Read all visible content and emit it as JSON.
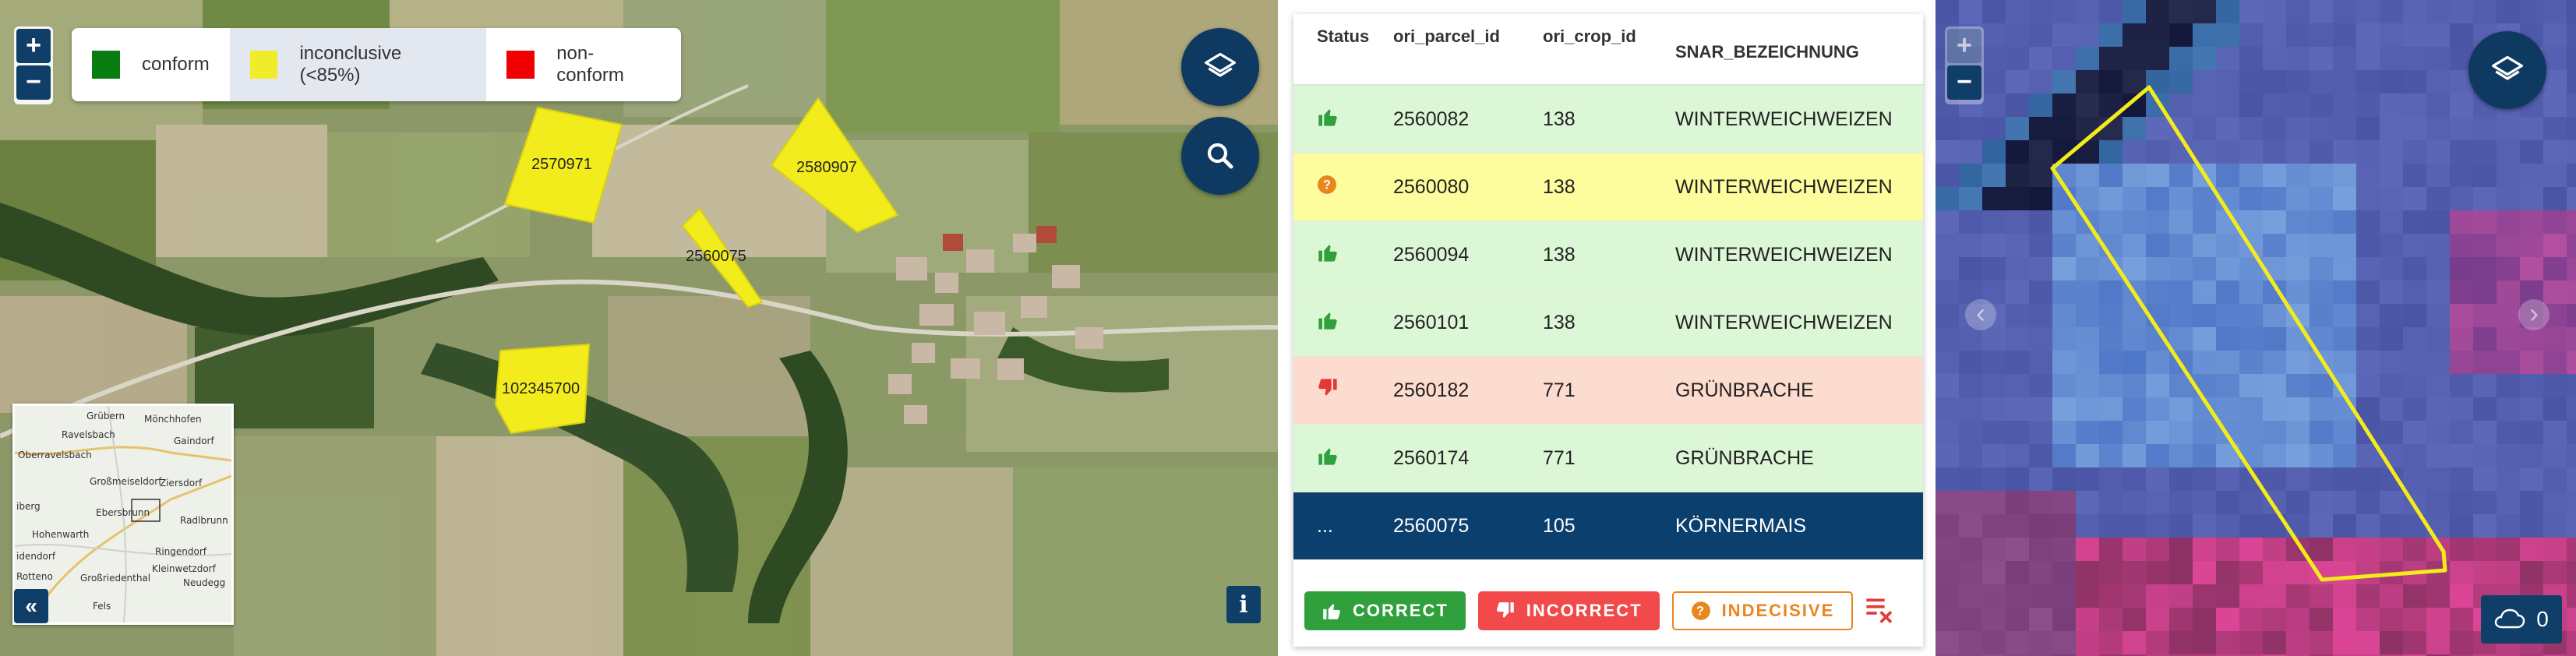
{
  "left_map": {
    "zoom_in": "+",
    "zoom_out": "−",
    "legend": [
      {
        "label": "conform",
        "color": "#0a7d12"
      },
      {
        "label": "inconclusive (<85%)",
        "color": "#f0ec2a",
        "active": true
      },
      {
        "label": "non-conform",
        "color": "#f00000"
      }
    ],
    "parcels": [
      "2570971",
      "2580907",
      "2560075",
      "102345700"
    ],
    "layers_icon": "layers-icon",
    "search_icon": "search-icon",
    "collapse_label": "«",
    "info_label": "i",
    "overview_labels": [
      "Grübern",
      "Mönchhofen",
      "Ravelsbach",
      "Gaindorf",
      "Oberravelsbach",
      "Großmeiseldorf",
      "Ziersdorf",
      "iberg",
      "Ebersbrunn",
      "Hohenwarth",
      "Radlbrunn",
      "idendorf",
      "Ringendorf",
      "Kleinwetzdorf",
      "Rotteno",
      "Großriedenthal",
      "Neudegg",
      "Fels"
    ]
  },
  "table": {
    "columns": [
      "Status",
      "ori_parcel_id",
      "ori_crop_id",
      "SNAR_BEZEICHNUNG"
    ],
    "rows": [
      {
        "status": "thumbs-up",
        "parcel": "2560082",
        "crop": "138",
        "name": "WINTERWEICHWEIZEN",
        "state": "green"
      },
      {
        "status": "question",
        "parcel": "2560080",
        "crop": "138",
        "name": "WINTERWEICHWEIZEN",
        "state": "yellow"
      },
      {
        "status": "thumbs-up",
        "parcel": "2560094",
        "crop": "138",
        "name": "WINTERWEICHWEIZEN",
        "state": "green"
      },
      {
        "status": "thumbs-up",
        "parcel": "2560101",
        "crop": "138",
        "name": "WINTERWEICHWEIZEN",
        "state": "green"
      },
      {
        "status": "thumbs-down",
        "parcel": "2560182",
        "crop": "771",
        "name": "GRÜNBRACHE",
        "state": "red"
      },
      {
        "status": "thumbs-up",
        "parcel": "2560174",
        "crop": "771",
        "name": "GRÜNBRACHE",
        "state": "green"
      },
      {
        "status": "...",
        "parcel": "2560075",
        "crop": "105",
        "name": "KÖRNERMAIS",
        "state": "selected"
      }
    ],
    "actions": {
      "correct": "CORRECT",
      "incorrect": "INCORRECT",
      "indecisive": "INDECISIVE"
    }
  },
  "right_map": {
    "zoom_in": "+",
    "zoom_out": "−",
    "prev": "‹",
    "next": "›",
    "cloud_count": "0"
  },
  "colors": {
    "accent": "#0f3f68",
    "correct": "#2fa03c",
    "incorrect": "#f24a4a",
    "indecisive": "#e9861d",
    "parcel_fill": "#f0ec2a"
  }
}
